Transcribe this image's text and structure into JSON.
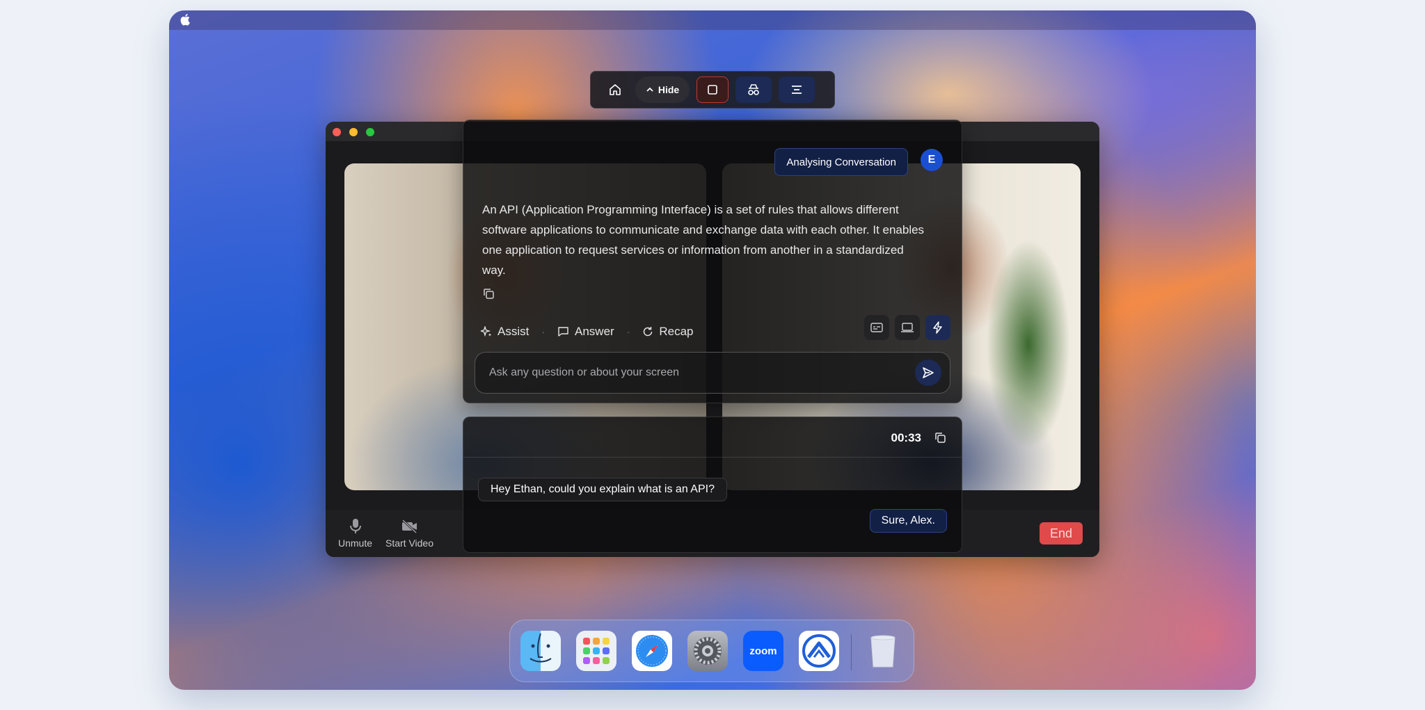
{
  "toolbar": {
    "hide_label": "Hide"
  },
  "meeting": {
    "controls": {
      "unmute_label": "Unmute",
      "start_video_label": "Start Video",
      "end_label": "End"
    }
  },
  "assistant": {
    "status": "Analysing Conversation",
    "avatar_initial": "E",
    "answer": "An API (Application Programming Interface) is a set of rules that allows different software applications to communicate and exchange data with each other. It enables one application to request services or information from another in a standardized way.",
    "modes": {
      "assist": "Assist",
      "answer": "Answer",
      "recap": "Recap",
      "separator": "·"
    },
    "input_placeholder": "Ask any question or about your screen"
  },
  "transcript": {
    "timer": "00:33",
    "messages": [
      {
        "speaker": "other",
        "text": "Hey Ethan, could you explain what is an API?"
      },
      {
        "speaker": "self",
        "text": "Sure, Alex."
      }
    ]
  },
  "dock": {
    "apps": [
      "finder-icon",
      "launchpad-icon",
      "safari-icon",
      "system-settings-icon",
      "zoom-icon",
      "assistant-app-icon",
      "trash-icon"
    ],
    "zoom_label": "zoom"
  },
  "colors": {
    "accent_blue": "#1c2a55",
    "status_border": "#2c4482",
    "end_red": "#e04a4a",
    "stop_red": "#c0392b"
  }
}
